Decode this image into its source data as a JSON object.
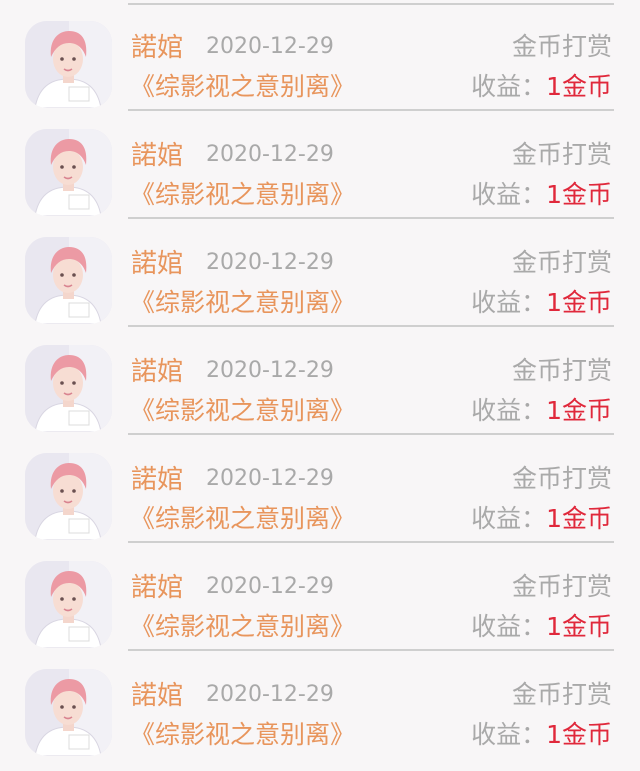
{
  "items": [
    {
      "name": "諾婠",
      "date": "2020-12-29",
      "type": "金币打赏",
      "book": "《综影视之意别离》",
      "earnings_label": "收益：",
      "earnings_value": "1金币"
    },
    {
      "name": "諾婠",
      "date": "2020-12-29",
      "type": "金币打赏",
      "book": "《综影视之意别离》",
      "earnings_label": "收益：",
      "earnings_value": "1金币"
    },
    {
      "name": "諾婠",
      "date": "2020-12-29",
      "type": "金币打赏",
      "book": "《综影视之意别离》",
      "earnings_label": "收益：",
      "earnings_value": "1金币"
    },
    {
      "name": "諾婠",
      "date": "2020-12-29",
      "type": "金币打赏",
      "book": "《综影视之意别离》",
      "earnings_label": "收益：",
      "earnings_value": "1金币"
    },
    {
      "name": "諾婠",
      "date": "2020-12-29",
      "type": "金币打赏",
      "book": "《综影视之意别离》",
      "earnings_label": "收益：",
      "earnings_value": "1金币"
    },
    {
      "name": "諾婠",
      "date": "2020-12-29",
      "type": "金币打赏",
      "book": "《综影视之意别离》",
      "earnings_label": "收益：",
      "earnings_value": "1金币"
    },
    {
      "name": "諾婠",
      "date": "2020-12-29",
      "type": "金币打赏",
      "book": "《综影视之意别离》",
      "earnings_label": "收益：",
      "earnings_value": "1金币"
    }
  ]
}
